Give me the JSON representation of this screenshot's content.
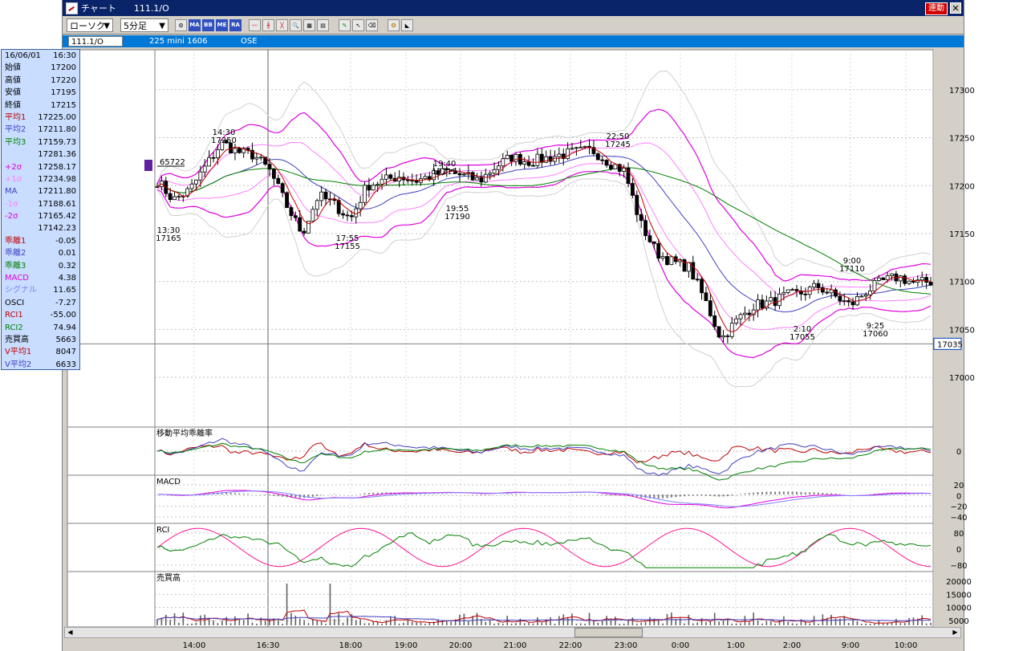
{
  "window": {
    "title": "チャート",
    "symbol_code": "111.1/O",
    "link_label": "連動",
    "close_label": "✕"
  },
  "toolbar": {
    "view_combo": "ローソク",
    "interval_combo": "5分足",
    "buttons": [
      "MA",
      "BB",
      "ME",
      "RA"
    ]
  },
  "symbar": {
    "symbol": "111.1/O",
    "contract": "225 mini 1606",
    "exchange": "OSE"
  },
  "info_panel": {
    "date": "16/06/01",
    "time": "16:30",
    "rows": [
      {
        "label": "始値",
        "value": "17200",
        "color": "#000000"
      },
      {
        "label": "高値",
        "value": "17220",
        "color": "#000000"
      },
      {
        "label": "安値",
        "value": "17195",
        "color": "#000000"
      },
      {
        "label": "終値",
        "value": "17215",
        "color": "#000000"
      },
      {
        "label": "平均1",
        "value": "17225.00",
        "color": "#c00000"
      },
      {
        "label": "平均2",
        "value": "17211.80",
        "color": "#4040c0"
      },
      {
        "label": "平均3",
        "value": "17159.73",
        "color": "#008000"
      },
      {
        "label": "",
        "value": "17281.36",
        "color": "#000000"
      },
      {
        "label": "+2σ",
        "value": "17258.17",
        "color": "#e000e0"
      },
      {
        "label": "+1σ",
        "value": "17234.98",
        "color": "#ff80ff"
      },
      {
        "label": "MA",
        "value": "17211.80",
        "color": "#4040c0"
      },
      {
        "label": "-1σ",
        "value": "17188.61",
        "color": "#ff80ff"
      },
      {
        "label": "-2σ",
        "value": "17165.42",
        "color": "#e000e0"
      },
      {
        "label": "",
        "value": "17142.23",
        "color": "#000000"
      },
      {
        "label": "乖離1",
        "value": "-0.05",
        "color": "#c00000"
      },
      {
        "label": "乖離2",
        "value": "0.01",
        "color": "#4040c0"
      },
      {
        "label": "乖離3",
        "value": "0.32",
        "color": "#008000"
      },
      {
        "label": "MACD",
        "value": "4.38",
        "color": "#e000e0"
      },
      {
        "label": "シグナル",
        "value": "11.65",
        "color": "#8080ff"
      },
      {
        "label": "OSCI",
        "value": "-7.27",
        "color": "#000000"
      },
      {
        "label": "RCI1",
        "value": "-55.00",
        "color": "#c00000"
      },
      {
        "label": "RCI2",
        "value": "74.94",
        "color": "#008000"
      },
      {
        "label": "売買高",
        "value": "5663",
        "color": "#000000"
      },
      {
        "label": "V平均1",
        "value": "8047",
        "color": "#c00000"
      },
      {
        "label": "V平均2",
        "value": "6633",
        "color": "#4040c0"
      }
    ]
  },
  "chart_data": [
    {
      "type": "candlestick",
      "title": "",
      "y_ticks": [
        "17300",
        "17250",
        "17200",
        "17150",
        "17100",
        "17050",
        "17000"
      ],
      "ylim": [
        16975,
        17335
      ],
      "current_price": "17035",
      "volume_marker": "65722",
      "annotations": [
        {
          "time": "13:30",
          "price": "17165"
        },
        {
          "time": "14:30",
          "price": "17250"
        },
        {
          "time": "17:55",
          "price": "17155"
        },
        {
          "time": "19:40",
          "price": "17215"
        },
        {
          "time": "19:55",
          "price": "17190"
        },
        {
          "time": "22:50",
          "price": "17245"
        },
        {
          "time": "2:10",
          "price": "17055"
        },
        {
          "time": "9:00",
          "price": "17110"
        },
        {
          "time": "9:25",
          "price": "17060"
        }
      ],
      "close_path": [
        17205,
        17185,
        17195,
        17220,
        17245,
        17235,
        17232,
        17215,
        17180,
        17150,
        17190,
        17180,
        17165,
        17200,
        17205,
        17210,
        17205,
        17210,
        17215,
        17210,
        17205,
        17220,
        17230,
        17225,
        17228,
        17232,
        17235,
        17237,
        17225,
        17215,
        17160,
        17130,
        17120,
        17115,
        17080,
        17040,
        17060,
        17075,
        17078,
        17085,
        17088,
        17095,
        17085,
        17075,
        17090,
        17100,
        17105,
        17098,
        17100
      ]
    },
    {
      "type": "line",
      "title": "移動平均乖離率",
      "y_ticks": [
        "0"
      ]
    },
    {
      "type": "bar",
      "title": "MACD",
      "y_ticks": [
        "20",
        "0",
        "−20",
        "−40"
      ]
    },
    {
      "type": "line",
      "title": "RCI",
      "y_ticks": [
        "80",
        "0",
        "−80"
      ]
    },
    {
      "type": "bar",
      "title": "売買高",
      "y_ticks": [
        "20000",
        "15000",
        "10000",
        "5000"
      ]
    }
  ],
  "x_axis": {
    "labels": [
      "14:00",
      "16:30",
      "18:00",
      "19:00",
      "20:00",
      "21:00",
      "22:00",
      "23:00",
      "0:00",
      "1:00",
      "2:00",
      "9:00",
      "10:00"
    ]
  }
}
